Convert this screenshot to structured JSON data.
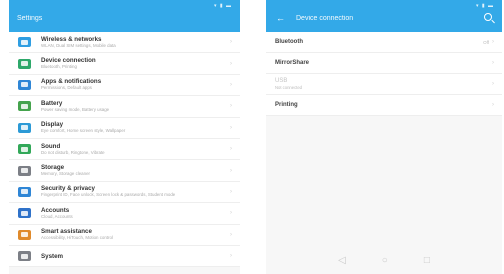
{
  "left": {
    "status": "▾ ▮ ▬",
    "title": "Settings",
    "items": [
      {
        "icon": "wireless-icon",
        "color": "#2f9ee2",
        "title": "Wireless & networks",
        "subtitle": "WLAN, Dual SIM settings, Mobile data"
      },
      {
        "icon": "device-connection-icon",
        "color": "#2ea86a",
        "title": "Device connection",
        "subtitle": "Bluetooth, Printing"
      },
      {
        "icon": "apps-icon",
        "color": "#2f86d6",
        "title": "Apps & notifications",
        "subtitle": "Permissions, Default apps"
      },
      {
        "icon": "battery-icon",
        "color": "#45a34d",
        "title": "Battery",
        "subtitle": "Power saving mode, Battery usage"
      },
      {
        "icon": "display-icon",
        "color": "#2c9ad6",
        "title": "Display",
        "subtitle": "Eye comfort, Home screen style, Wallpaper"
      },
      {
        "icon": "sound-icon",
        "color": "#32a859",
        "title": "Sound",
        "subtitle": "Do not disturb, Ringtone, Vibrate"
      },
      {
        "icon": "storage-icon",
        "color": "#7c7f86",
        "title": "Storage",
        "subtitle": "Memory, Storage cleaner"
      },
      {
        "icon": "security-icon",
        "color": "#2f86d6",
        "title": "Security & privacy",
        "subtitle": "Fingerprint ID, Face unlock, Screen lock & passwords, Student mode"
      },
      {
        "icon": "accounts-icon",
        "color": "#2f72c9",
        "title": "Accounts",
        "subtitle": "Cloud, Accounts"
      },
      {
        "icon": "smart-assistance-icon",
        "color": "#e08a2b",
        "title": "Smart assistance",
        "subtitle": "Accessibility, HiTouch, Motion control"
      },
      {
        "icon": "system-icon",
        "color": "#7c7f86",
        "title": "System",
        "subtitle": ""
      }
    ]
  },
  "right": {
    "status": "▾ ▮ ▬",
    "title": "Device connection",
    "items": [
      {
        "title": "Bluetooth",
        "subtitle": "",
        "value": "Off",
        "disabled": false
      },
      {
        "title": "MirrorShare",
        "subtitle": "",
        "value": "",
        "disabled": false
      },
      {
        "title": "USB",
        "subtitle": "Not connected",
        "value": "",
        "disabled": true
      },
      {
        "title": "Printing",
        "subtitle": "",
        "value": "",
        "disabled": false
      }
    ],
    "nav": [
      "◁",
      "○",
      "□"
    ]
  }
}
